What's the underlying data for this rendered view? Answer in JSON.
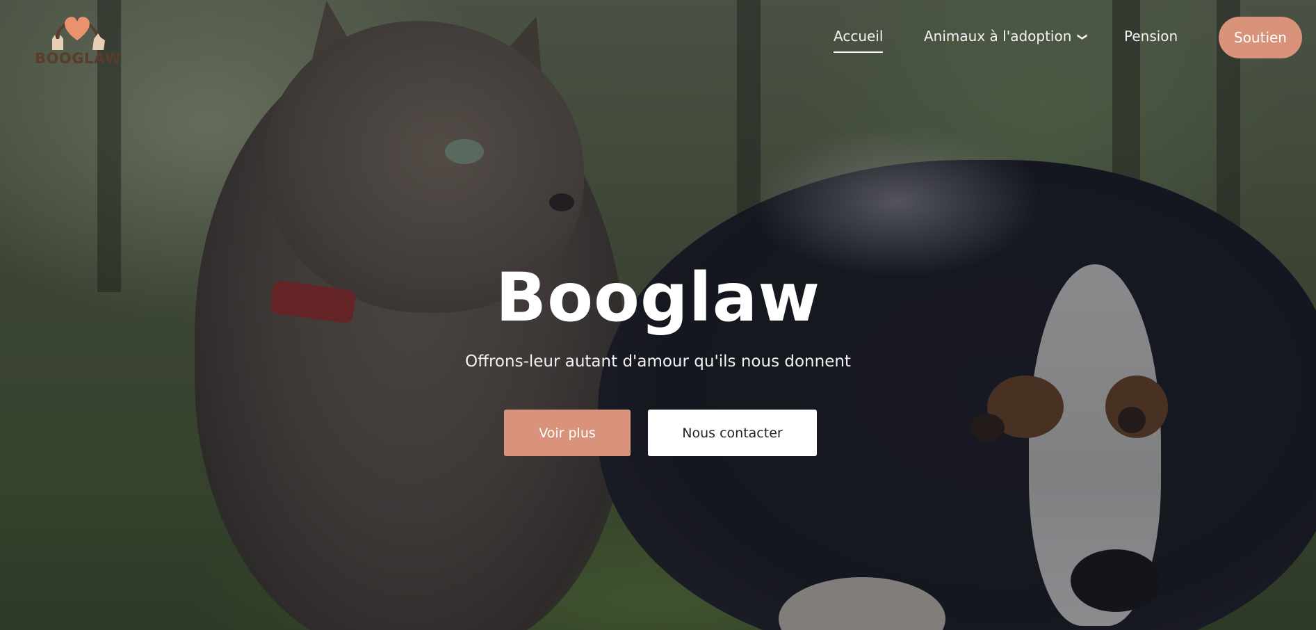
{
  "brand": {
    "name": "BOOGLAW",
    "colors": {
      "accent": "#d9937a",
      "logo_text": "#5a3c2a",
      "heart": "#e8926e"
    }
  },
  "nav": {
    "items": [
      {
        "label": "Accueil",
        "active": true
      },
      {
        "label": "Animaux à l'adoption",
        "has_dropdown": true,
        "icon": "chevron-down-icon"
      },
      {
        "label": "Pension"
      }
    ],
    "cta_label": "Soutien"
  },
  "hero": {
    "title": "Booglaw",
    "subtitle": "Offrons-leur autant d'amour qu'ils nous donnent",
    "primary_button": "Voir plus",
    "secondary_button": "Nous contacter"
  }
}
